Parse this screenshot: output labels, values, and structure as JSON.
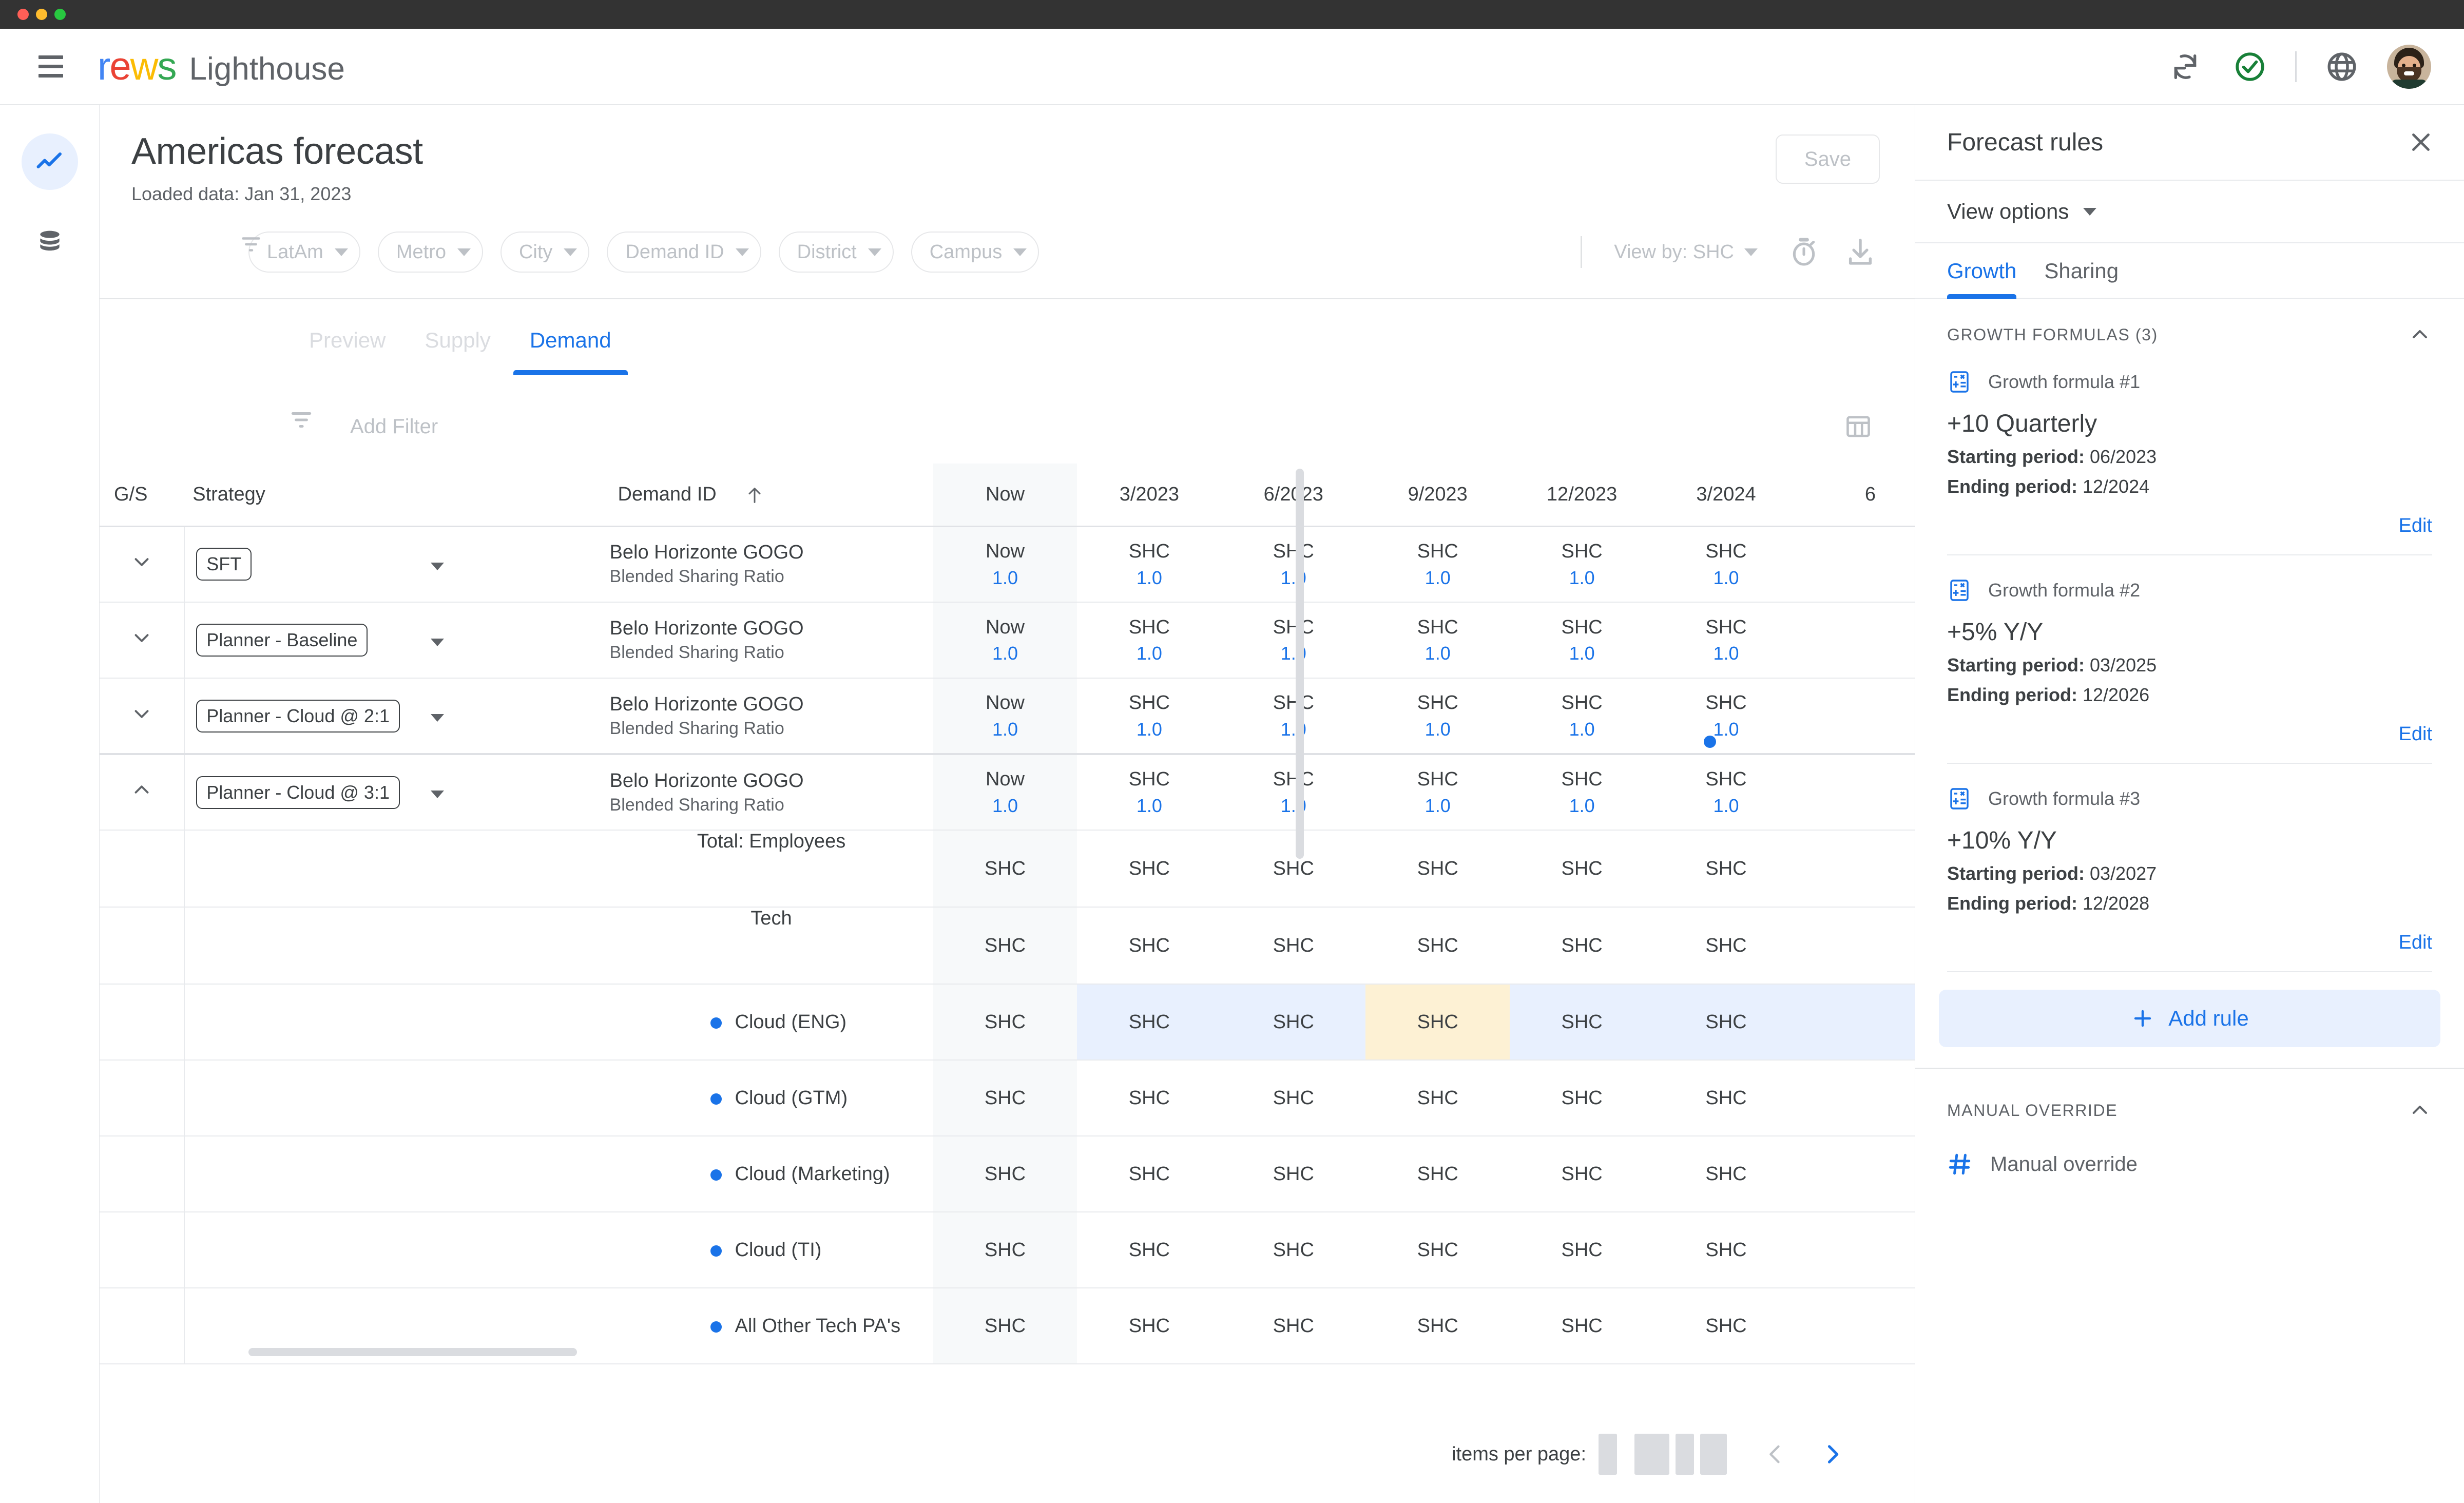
{
  "window": {
    "controls": [
      "close",
      "minimize",
      "maximize"
    ]
  },
  "appbar": {
    "menu_icon": "hamburger-icon",
    "logo_parts": [
      "r",
      "e",
      "w",
      "s"
    ],
    "product_name": "Lighthouse",
    "icons": [
      "sync-icon",
      "check-circle-icon",
      "globe-icon",
      "avatar"
    ],
    "status_color": "#188038"
  },
  "rail": {
    "items": [
      {
        "icon": "trending-up-icon",
        "active": true
      },
      {
        "icon": "database-icon",
        "active": false
      }
    ]
  },
  "page": {
    "title": "Americas forecast",
    "subtitle": "Loaded data: Jan 31, 2023",
    "save_label": "Save"
  },
  "filters": {
    "icon": "filter-list-icon",
    "chips": [
      "LatAm",
      "Metro",
      "City",
      "Demand ID",
      "District",
      "Campus"
    ],
    "view_by_label": "View by: SHC",
    "timer_icon": "timer-icon",
    "download_icon": "download-icon"
  },
  "tabs": [
    {
      "label": "Preview",
      "active": false
    },
    {
      "label": "Supply",
      "active": false
    },
    {
      "label": "Demand",
      "active": true
    }
  ],
  "table_toolbar": {
    "filter_icon": "filter-list-icon",
    "add_filter_label": "Add Filter",
    "columns_icon": "table-columns-icon"
  },
  "table": {
    "headers": {
      "gs": "G/S",
      "strategy": "Strategy",
      "demand_id": "Demand ID",
      "sort_icon": "arrow-up-icon",
      "periods": [
        "Now",
        "3/2023",
        "6/2023",
        "9/2023",
        "12/2023",
        "3/2024",
        "6"
      ]
    },
    "strategy_rows": [
      {
        "chevron": "chevron-down-icon",
        "tag": "SFT",
        "demand_id": "Belo Horizonte GOGO",
        "demand_sub": "Blended Sharing Ratio",
        "cells": [
          {
            "label": "Now",
            "value": "1.0"
          },
          {
            "label": "SHC",
            "value": "1.0"
          },
          {
            "label": "SHC",
            "value": "1.0"
          },
          {
            "label": "SHC",
            "value": "1.0"
          },
          {
            "label": "SHC",
            "value": "1.0"
          },
          {
            "label": "SHC",
            "value": "1.0"
          }
        ]
      },
      {
        "chevron": "chevron-down-icon",
        "tag": "Planner - Baseline",
        "demand_id": "Belo Horizonte GOGO",
        "demand_sub": "Blended Sharing Ratio",
        "cells": [
          {
            "label": "Now",
            "value": "1.0"
          },
          {
            "label": "SHC",
            "value": "1.0"
          },
          {
            "label": "SHC",
            "value": "1.0"
          },
          {
            "label": "SHC",
            "value": "1.0"
          },
          {
            "label": "SHC",
            "value": "1.0"
          },
          {
            "label": "SHC",
            "value": "1.0"
          }
        ]
      },
      {
        "chevron": "chevron-down-icon",
        "tag": "Planner - Cloud @ 2:1",
        "demand_id": "Belo Horizonte GOGO",
        "demand_sub": "Blended Sharing Ratio",
        "cells": [
          {
            "label": "Now",
            "value": "1.0"
          },
          {
            "label": "SHC",
            "value": "1.0"
          },
          {
            "label": "SHC",
            "value": "1.0"
          },
          {
            "label": "SHC",
            "value": "1.0"
          },
          {
            "label": "SHC",
            "value": "1.0"
          },
          {
            "label": "SHC",
            "value": "1.0"
          }
        ]
      },
      {
        "chevron": "chevron-up-icon",
        "tag": "Planner - Cloud @ 3:1",
        "demand_id": "Belo Horizonte GOGO",
        "demand_sub": "Blended Sharing Ratio",
        "cells": [
          {
            "label": "Now",
            "value": "1.0"
          },
          {
            "label": "SHC",
            "value": "1.0"
          },
          {
            "label": "SHC",
            "value": "1.0"
          },
          {
            "label": "SHC",
            "value": "1.0"
          },
          {
            "label": "SHC",
            "value": "1.0"
          },
          {
            "label": "SHC",
            "value": "1.0"
          }
        ]
      }
    ],
    "detail_rows": [
      {
        "label": "Total: Employees",
        "style": "center",
        "bullet": false,
        "selected": false,
        "cells": [
          "SHC",
          "SHC",
          "SHC",
          "SHC",
          "SHC",
          "SHC"
        ]
      },
      {
        "label": "Tech",
        "style": "center",
        "bullet": false,
        "selected": false,
        "cells": [
          "SHC",
          "SHC",
          "SHC",
          "SHC",
          "SHC",
          "SHC"
        ]
      },
      {
        "label": "Cloud (ENG)",
        "style": "indent",
        "bullet": true,
        "selected": true,
        "highlight_index": 3,
        "cells": [
          "SHC",
          "SHC",
          "SHC",
          "SHC",
          "SHC",
          "SHC"
        ]
      },
      {
        "label": "Cloud (GTM)",
        "style": "indent",
        "bullet": true,
        "selected": false,
        "cells": [
          "SHC",
          "SHC",
          "SHC",
          "SHC",
          "SHC",
          "SHC"
        ]
      },
      {
        "label": "Cloud (Marketing)",
        "style": "indent",
        "bullet": true,
        "selected": false,
        "cells": [
          "SHC",
          "SHC",
          "SHC",
          "SHC",
          "SHC",
          "SHC"
        ]
      },
      {
        "label": "Cloud (TI)",
        "style": "indent",
        "bullet": true,
        "selected": false,
        "cells": [
          "SHC",
          "SHC",
          "SHC",
          "SHC",
          "SHC",
          "SHC"
        ]
      },
      {
        "label": "All Other Tech PA's",
        "style": "indent",
        "bullet": true,
        "selected": false,
        "cells": [
          "SHC",
          "SHC",
          "SHC",
          "SHC",
          "SHC",
          "SHC"
        ]
      }
    ]
  },
  "pagination": {
    "items_per_page_label": "items per page:",
    "prev_icon": "chevron-left-icon",
    "next_icon": "chevron-right-icon"
  },
  "panel": {
    "title": "Forecast rules",
    "close_icon": "close-icon",
    "view_options_label": "View options",
    "tabs": [
      {
        "label": "Growth",
        "active": true
      },
      {
        "label": "Sharing",
        "active": false
      }
    ],
    "growth_section": {
      "title": "GROWTH FORMULAS (3)",
      "collapse_icon": "chevron-up-icon",
      "rules": [
        {
          "icon": "calculator-icon",
          "name": "Growth formula #1",
          "value": "+10 Quarterly",
          "start_label": "Starting period:",
          "start": "06/2023",
          "end_label": "Ending period:",
          "end": "12/2024",
          "edit_label": "Edit"
        },
        {
          "icon": "calculator-icon",
          "name": "Growth formula #2",
          "value": "+5% Y/Y",
          "start_label": "Starting period:",
          "start": "03/2025",
          "end_label": "Ending period:",
          "end": "12/2026",
          "edit_label": "Edit"
        },
        {
          "icon": "calculator-icon",
          "name": "Growth formula #3",
          "value": "+10% Y/Y",
          "start_label": "Starting period:",
          "start": "03/2027",
          "end_label": "Ending period:",
          "end": "12/2028",
          "edit_label": "Edit"
        }
      ],
      "add_rule_label": "Add rule",
      "add_icon": "plus-icon"
    },
    "manual_override": {
      "title": "MANUAL OVERRIDE",
      "collapse_icon": "chevron-up-icon",
      "icon": "hash-icon",
      "label": "Manual override"
    }
  },
  "colors": {
    "accent": "#1a73e8",
    "selected_row_bg": "#e8f0fe",
    "highlight_cell_bg": "#fdf1d4",
    "now_col_bg": "#f7f9fa",
    "success": "#188038"
  }
}
